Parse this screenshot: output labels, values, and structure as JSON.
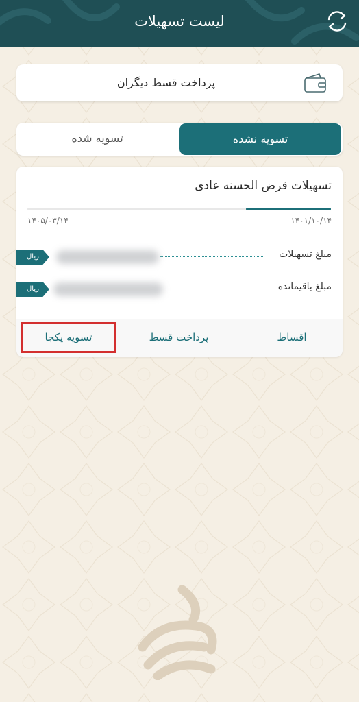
{
  "header": {
    "title": "لیست تسهیلات",
    "refresh_icon": "refresh-icon"
  },
  "pay_other": {
    "label": "پرداخت قسط دیگران",
    "icon": "wallet-icon"
  },
  "tabs": [
    {
      "label": "تسویه نشده",
      "active": true
    },
    {
      "label": "تسویه شده",
      "active": false
    }
  ],
  "loan": {
    "title": "تسهیلات قرض الحسنه عادی",
    "progress_fraction": 0.28,
    "start_date": "۱۴۰۱/۱۰/۱۴",
    "end_date": "۱۴۰۵/۰۳/۱۴",
    "rows": [
      {
        "label": "مبلغ تسهیلات",
        "currency": "ریال"
      },
      {
        "label": "مبلغ باقیمانده",
        "currency": "ریال"
      }
    ],
    "actions": {
      "installments": "اقساط",
      "pay_installment": "پرداخت قسط",
      "settle_all": "تسویه یکجا"
    }
  },
  "colors": {
    "header_bg": "#1f4f55",
    "accent": "#1c6f78",
    "page_bg": "#f5efe4",
    "highlight": "#d32f2f"
  }
}
